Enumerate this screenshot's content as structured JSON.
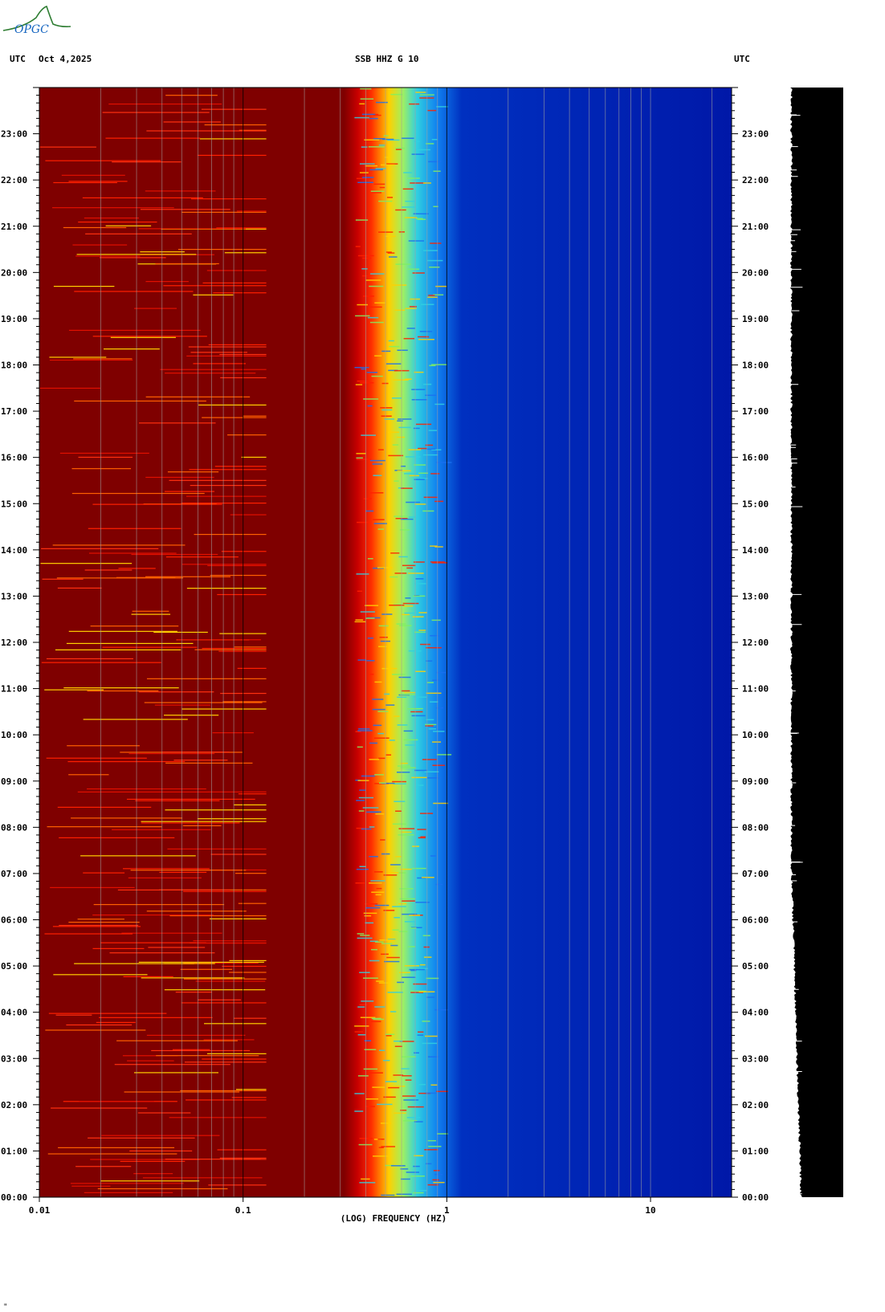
{
  "header": {
    "left_label": "UTC",
    "date": "Oct 4,2025",
    "station": "SSB HHZ G 10",
    "right_label": "UTC"
  },
  "logo": {
    "text": "OPGC",
    "color": "#2e7d32"
  },
  "colors": {
    "low_freq": "#7f0000",
    "mid": "#ff2000",
    "transition_yellow": "#ffe000",
    "transition_cyan": "#40e0d0",
    "high_freq": "#0018a8",
    "gridline": "#a0a0a0",
    "trace": "#000000"
  },
  "chart_data": {
    "type": "heatmap",
    "title": "SSB HHZ G 10",
    "xlabel": "(LOG) FREQUENCY (HZ)",
    "x_scale": "log",
    "xlim": [
      0.01,
      25
    ],
    "x_ticks": [
      "0.01",
      "0.1",
      "1",
      "10"
    ],
    "y_ticks_left": [
      "00:00",
      "01:00",
      "02:00",
      "03:00",
      "04:00",
      "05:00",
      "06:00",
      "07:00",
      "08:00",
      "09:00",
      "10:00",
      "11:00",
      "12:00",
      "13:00",
      "14:00",
      "15:00",
      "16:00",
      "17:00",
      "18:00",
      "19:00",
      "20:00",
      "21:00",
      "22:00",
      "23:00"
    ],
    "y_ticks_right": [
      "00:00",
      "01:00",
      "02:00",
      "03:00",
      "04:00",
      "05:00",
      "06:00",
      "07:00",
      "08:00",
      "09:00",
      "10:00",
      "11:00",
      "12:00",
      "13:00",
      "14:00",
      "15:00",
      "16:00",
      "17:00",
      "18:00",
      "19:00",
      "20:00",
      "21:00",
      "22:00",
      "23:00"
    ],
    "ylim_hours": [
      0,
      24
    ],
    "transition_band_hz": [
      0.35,
      0.9
    ],
    "grid_frequencies_hz": [
      0.02,
      0.03,
      0.04,
      0.05,
      0.06,
      0.07,
      0.08,
      0.09,
      0.1,
      0.2,
      0.3,
      0.4,
      0.5,
      0.6,
      0.7,
      0.8,
      0.9,
      1,
      2,
      3,
      4,
      5,
      6,
      7,
      8,
      9,
      10,
      20
    ],
    "grid": true
  },
  "footer": {
    "mark": "\""
  }
}
